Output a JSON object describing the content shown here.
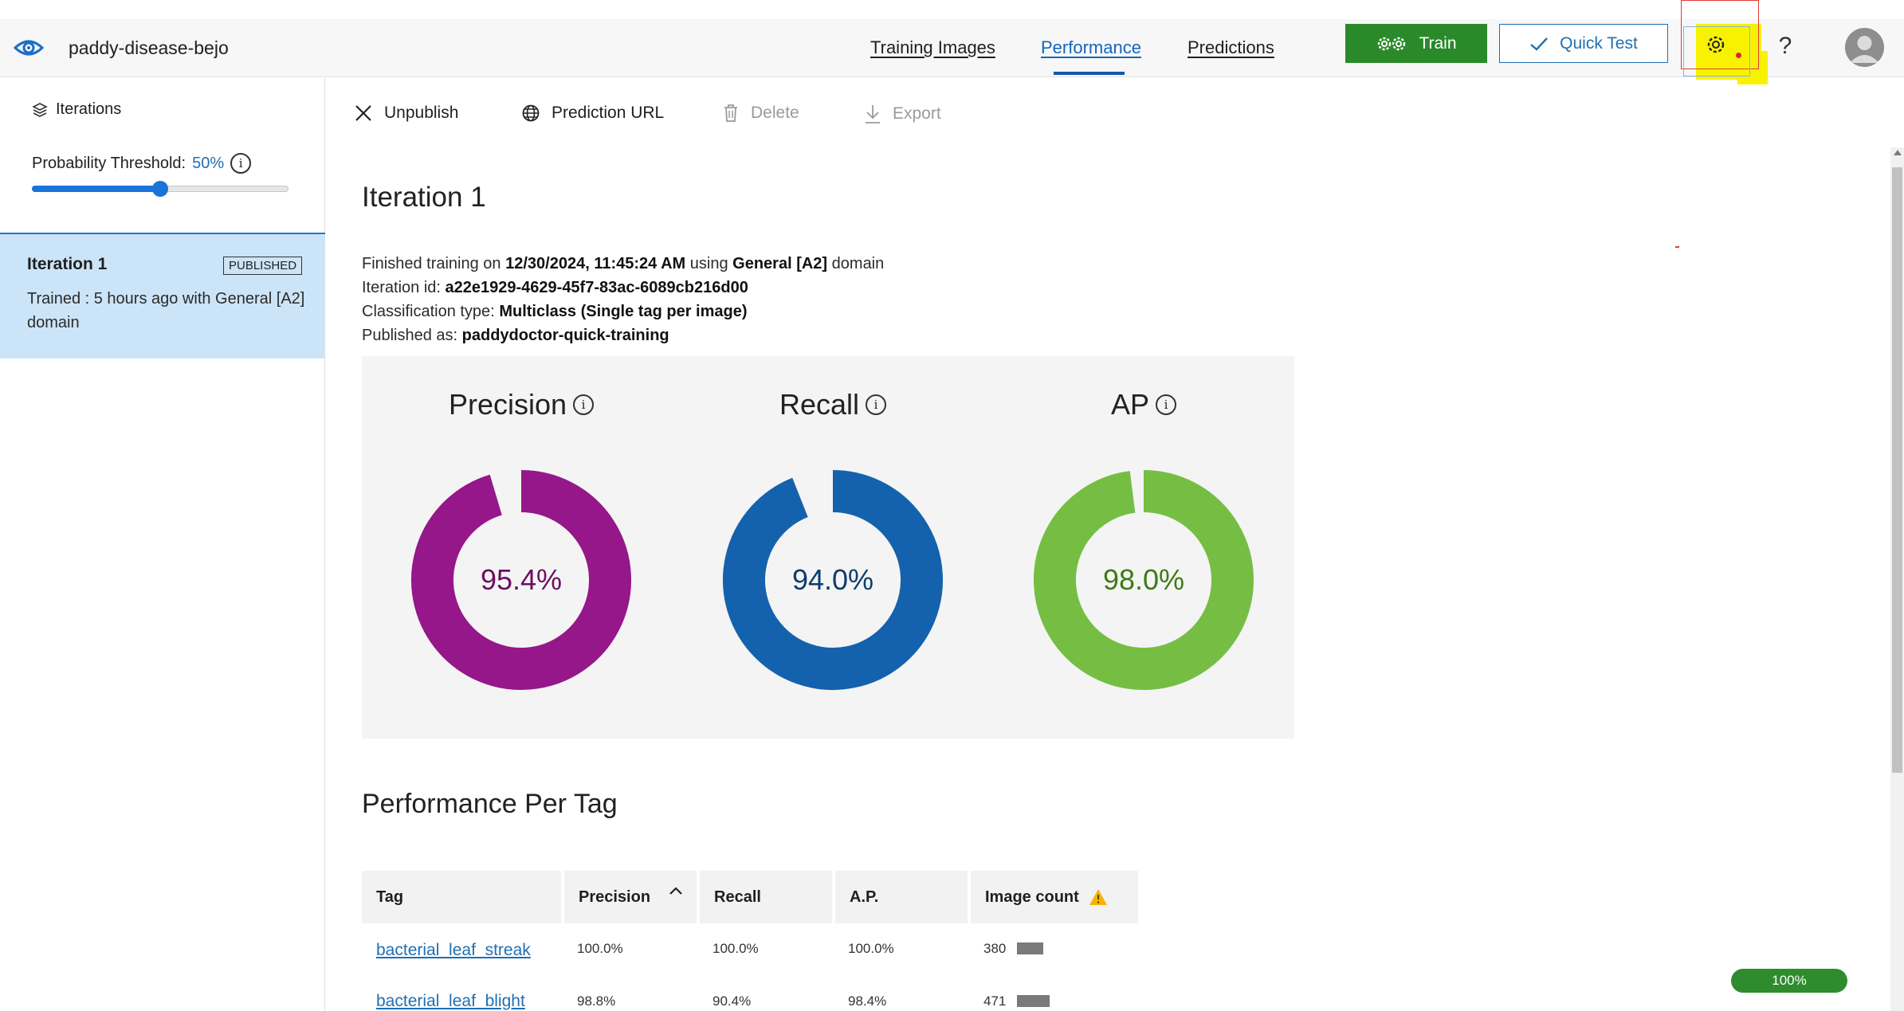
{
  "header": {
    "project_name": "paddy-disease-bejo",
    "tabs": [
      {
        "label": "Training Images",
        "active": false
      },
      {
        "label": "Performance",
        "active": true
      },
      {
        "label": "Predictions",
        "active": false
      }
    ],
    "train_label": "Train",
    "quick_test_label": "Quick Test",
    "help_label": "?",
    "icons": [
      "eye-logo-icon",
      "gears-icon",
      "check-icon",
      "gear-icon",
      "help-icon",
      "user-avatar-icon"
    ]
  },
  "sidebar": {
    "iterations_label": "Iterations",
    "threshold_label": "Probability Threshold:",
    "threshold_value": "50%",
    "threshold_fraction": 0.5,
    "iteration": {
      "title": "Iteration 1",
      "badge": "PUBLISHED",
      "description": "Trained : 5 hours ago with General [A2] domain"
    }
  },
  "toolbar": {
    "unpublish": "Unpublish",
    "prediction_url": "Prediction URL",
    "delete": "Delete",
    "export": "Export"
  },
  "main": {
    "title": "Iteration 1",
    "meta": {
      "finished_prefix": "Finished training on",
      "finished_date": "12/30/2024, 11:45:24 AM",
      "using": "using",
      "domain_name": "General [A2]",
      "domain_suffix": "domain",
      "iteration_id_label": "Iteration id:",
      "iteration_id": "a22e1929-4629-45f7-83ac-6089cb216d00",
      "classification_label": "Classification type:",
      "classification": "Multiclass (Single tag per image)",
      "published_label": "Published as:",
      "published": "paddydoctor-quick-training"
    },
    "metrics": [
      {
        "title": "Precision",
        "value": "95.4%",
        "fraction": 0.954,
        "color": "#95178a",
        "text_color": "#6b1060"
      },
      {
        "title": "Recall",
        "value": "94.0%",
        "fraction": 0.94,
        "color": "#1462ad",
        "text_color": "#0d3d6e"
      },
      {
        "title": "AP",
        "value": "98.0%",
        "fraction": 0.98,
        "color": "#75be43",
        "text_color": "#3d7a16"
      }
    ],
    "per_tag_title": "Performance Per Tag",
    "table": {
      "headers": [
        "Tag",
        "Precision",
        "Recall",
        "A.P.",
        "Image count"
      ],
      "rows": [
        {
          "tag": "bacterial_leaf_streak",
          "precision": "100.0%",
          "recall": "100.0%",
          "ap": "100.0%",
          "count": "380",
          "count_value": 380
        },
        {
          "tag": "bacterial_leaf_blight",
          "precision": "98.8%",
          "recall": "90.4%",
          "ap": "98.4%",
          "count": "471",
          "count_value": 471
        }
      ]
    }
  },
  "zoom": "100%"
}
